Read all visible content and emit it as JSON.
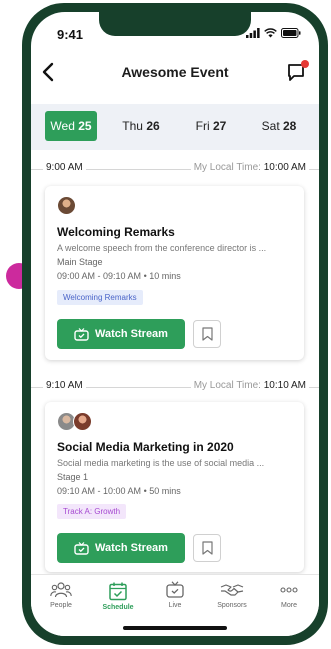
{
  "status": {
    "time": "9:41"
  },
  "header": {
    "title": "Awesome Event"
  },
  "days": [
    {
      "dow": "Wed",
      "num": "25",
      "active": true
    },
    {
      "dow": "Thu",
      "num": "26",
      "active": false
    },
    {
      "dow": "Fri",
      "num": "27",
      "active": false
    },
    {
      "dow": "Sat",
      "num": "28",
      "active": false
    }
  ],
  "slots": [
    {
      "time": "9:00 AM",
      "local_label": "My Local Time:",
      "local_time": "10:00 AM",
      "session": {
        "title": "Welcoming Remarks",
        "description": "A welcome speech from the conference director is ...",
        "venue": "Main Stage",
        "time_range": "09:00 AM - 09:10 AM",
        "duration": "10 mins",
        "tag": "Welcoming Remarks",
        "button": "Watch Stream"
      }
    },
    {
      "time": "9:10 AM",
      "local_label": "My Local Time:",
      "local_time": "10:10 AM",
      "session": {
        "title": "Social Media Marketing in 2020",
        "description": "Social media marketing is the use of social media ...",
        "venue": "Stage 1",
        "time_range": "09:10 AM - 10:00 AM",
        "duration": "50 mins",
        "tag": "Track A: Growth",
        "button": "Watch Stream"
      }
    }
  ],
  "tabs": [
    {
      "label": "People",
      "icon": "people-icon"
    },
    {
      "label": "Schedule",
      "icon": "calendar-check-icon",
      "active": true
    },
    {
      "label": "Live",
      "icon": "tv-icon"
    },
    {
      "label": "Sponsors",
      "icon": "handshake-icon"
    },
    {
      "label": "More",
      "icon": "more-dots-icon"
    }
  ],
  "colors": {
    "accent": "#2e9e5a",
    "frame": "#17402b",
    "notification": "#e53935"
  }
}
